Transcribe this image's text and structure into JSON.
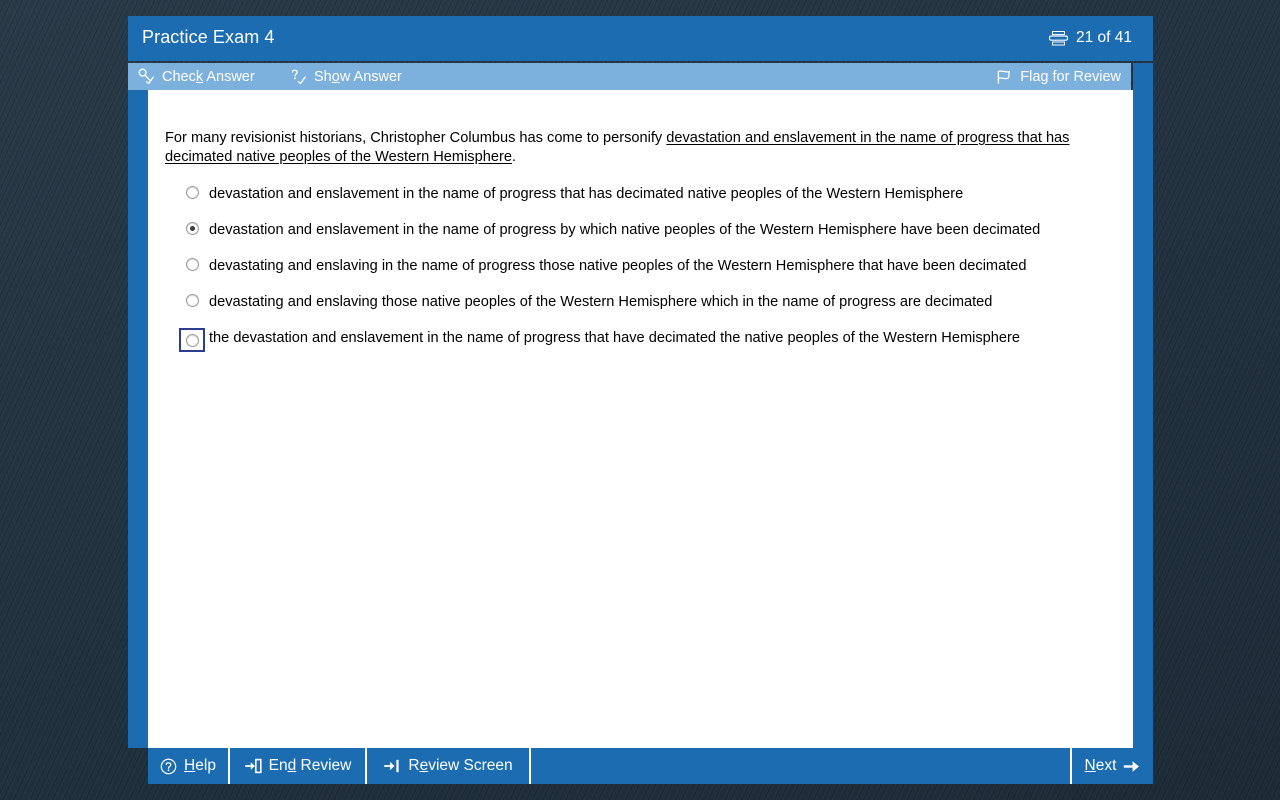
{
  "window": {
    "title": "Practice Exam 4",
    "counter": "21 of 41",
    "counter_icon": "stacked-pages-icon"
  },
  "top_toolbar": {
    "check_answer": {
      "label_pre": "Chec",
      "accel": "k",
      "label_post": " Answer",
      "icon": "key-check-icon"
    },
    "show_answer": {
      "label_pre": "Sh",
      "accel": "o",
      "label_post": "w Answer",
      "icon": "question-check-icon"
    },
    "flag_for_review": {
      "label": "Flag for Review",
      "icon": "flag-icon"
    }
  },
  "question": {
    "stem_pre": "For many revisionist historians, Christopher Columbus has come to personify ",
    "stem_underlined": "devastation and enslavement in the name of progress that has decimated native peoples of the Western Hemisphere",
    "stem_post": ".",
    "options": [
      {
        "text": "devastation and enslavement in the name of progress that has decimated native peoples of the Western Hemisphere",
        "selected": false,
        "focused": false
      },
      {
        "text": "devastation and enslavement in the name of progress by which native peoples of the Western Hemisphere have been decimated",
        "selected": true,
        "focused": false
      },
      {
        "text": "devastating and enslaving in the name of progress those native peoples of the Western Hemisphere that have been decimated",
        "selected": false,
        "focused": false
      },
      {
        "text": "devastating and enslaving those native peoples of the Western Hemisphere which in the name of progress are decimated",
        "selected": false,
        "focused": false
      },
      {
        "text": "the devastation and enslavement in the name of progress that have decimated the native peoples of the Western Hemisphere",
        "selected": false,
        "focused": true
      }
    ]
  },
  "bottom_bar": {
    "help": {
      "label_pre": "",
      "accel": "H",
      "label_post": "elp",
      "icon": "question-circle-icon"
    },
    "end_review": {
      "label_pre": "En",
      "accel": "d",
      "label_post": " Review",
      "icon": "exit-arrow-icon"
    },
    "review_screen": {
      "label_pre": "R",
      "accel": "e",
      "label_post": "view Screen",
      "icon": "arrow-to-bar-icon"
    },
    "next": {
      "label_pre": "",
      "accel": "N",
      "label_post": "ext",
      "icon": "arrow-right-icon"
    }
  },
  "colors": {
    "header_blue": "#1b6cb0",
    "toolbar_blue": "#7cb0dd",
    "desktop_bg": "#243442",
    "focus_outline": "#2c3e8f"
  }
}
